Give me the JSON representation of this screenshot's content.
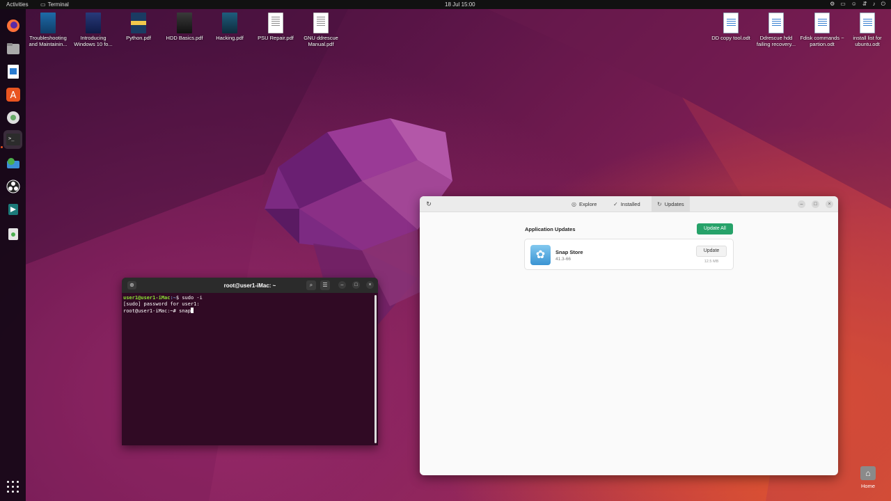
{
  "topbar": {
    "activities": "Activities",
    "app_name": "Terminal",
    "clock": "18 Jul  15:00"
  },
  "dock": {
    "items": [
      "firefox-icon",
      "files-icon",
      "libreoffice-writer-icon",
      "app-center-icon",
      "disks-icon",
      "terminal-icon",
      "install-icon",
      "obs-icon",
      "settings-icon",
      "trash-icon"
    ]
  },
  "desktop": {
    "left_icons": [
      {
        "label": "Troubleshooting and Maintainin..."
      },
      {
        "label": "Introducing Windows 10 fo..."
      },
      {
        "label": "Python.pdf"
      },
      {
        "label": "HDD Basics.pdf"
      },
      {
        "label": "Hacking.pdf"
      },
      {
        "label": "PSU Repair.pdf"
      },
      {
        "label": "GNU ddrescue Manual.pdf"
      }
    ],
    "right_icons": [
      {
        "label": "DD copy tool.odt"
      },
      {
        "label": "Ddrescue hdd failing recovery..."
      },
      {
        "label": "Fdisk commands ~ partion.odt"
      },
      {
        "label": "install list for ubuntu.odt"
      }
    ],
    "home_label": "Home"
  },
  "terminal": {
    "title": "root@user1-iMac: ~",
    "lines": [
      {
        "user": "user1@user1-iMac",
        "path": ":~",
        "prompt": "$ ",
        "cmd": "sudo -i"
      },
      {
        "text": "[sudo] password for user1:"
      },
      {
        "plain_prompt": "root@user1-iMac:~# ",
        "cmd": "snap"
      }
    ]
  },
  "store": {
    "tabs": {
      "explore": "Explore",
      "installed": "Installed",
      "updates": "Updates"
    },
    "section_title": "Application Updates",
    "update_all": "Update All",
    "app": {
      "name": "Snap Store",
      "version": "41.3-66",
      "button": "Update",
      "size": "12.5 MB"
    }
  },
  "colors": {
    "accent_green": "#26a269",
    "ubuntu_orange": "#e95420",
    "terminal_bg": "#300a24"
  }
}
